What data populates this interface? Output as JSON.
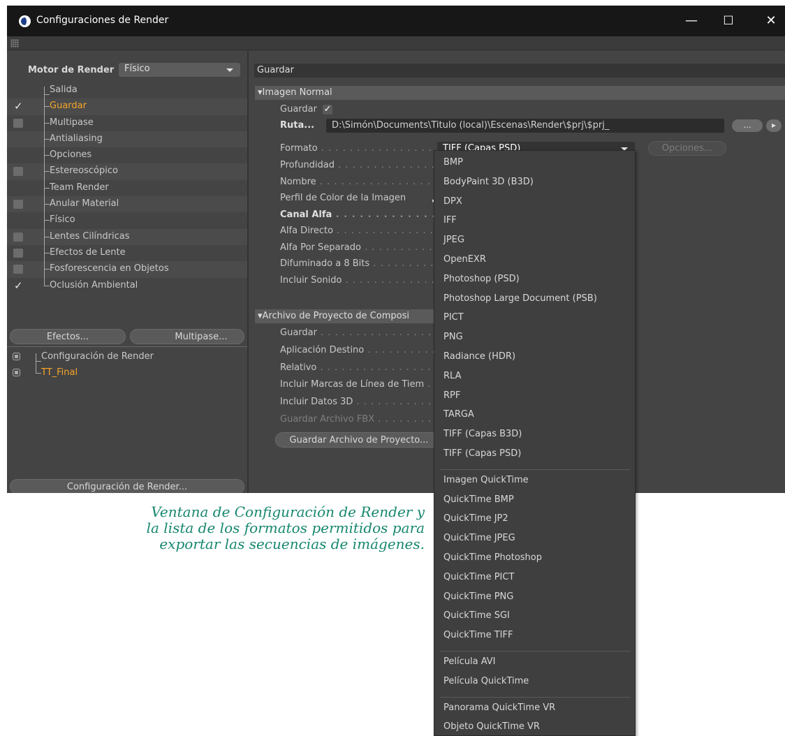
{
  "window": {
    "title": "Configuraciones de Render",
    "minimize": "—",
    "maximize": "☐",
    "close": "✕"
  },
  "left": {
    "engine_label": "Motor de Render",
    "engine_value": "Físico",
    "items": [
      {
        "label": "Salida",
        "checkbox": "none",
        "active": false
      },
      {
        "label": "Guardar",
        "checkbox": "checked",
        "active": true
      },
      {
        "label": "Multipase",
        "checkbox": "unchecked",
        "active": false
      },
      {
        "label": "Antialiasing",
        "checkbox": "none",
        "active": false
      },
      {
        "label": "Opciones",
        "checkbox": "none",
        "active": false
      },
      {
        "label": "Estereoscópico",
        "checkbox": "unchecked",
        "active": false
      },
      {
        "label": "Team Render",
        "checkbox": "none",
        "active": false
      },
      {
        "label": "Anular Material",
        "checkbox": "unchecked",
        "active": false
      },
      {
        "label": "Físico",
        "checkbox": "none",
        "active": false
      },
      {
        "label": "Lentes Cilíndricas",
        "checkbox": "unchecked",
        "active": false
      },
      {
        "label": "Efectos de Lente",
        "checkbox": "unchecked",
        "active": false
      },
      {
        "label": "Fosforescencia en Objetos",
        "checkbox": "unchecked",
        "active": false
      },
      {
        "label": "Oclusión Ambiental",
        "checkbox": "checked",
        "active": false
      }
    ],
    "effects_button": "Efectos...",
    "multipass_button": "Multipase...",
    "presets": [
      {
        "label": "Configuración de Render",
        "active": false
      },
      {
        "label": "TT_Final",
        "active": true
      }
    ],
    "render_settings_button": "Configuración de Render..."
  },
  "right": {
    "title": "Guardar",
    "section_image": "▾Imagen Normal",
    "guardar_label": "Guardar",
    "guardar_check": "✓",
    "ruta_label": "Ruta...",
    "path_value": "D:\\Simón\\Documents\\Titulo (local)\\Escenas\\Render\\$prj\\$prj_",
    "path_button": "...",
    "path_arrow": "▸",
    "format_label": "Formato",
    "format_value": "TIFF (Capas PSD)",
    "options_button": "Opciones...",
    "image_props": [
      {
        "label": "Profundidad",
        "style": "normal"
      },
      {
        "label": "Nombre",
        "style": "normal"
      },
      {
        "label": "Perfil de Color de la Imagen",
        "style": "normal"
      },
      {
        "label": "Canal Alfa",
        "style": "bold"
      },
      {
        "label": "Alfa Directo",
        "style": "normal"
      },
      {
        "label": "Alfa Por Separado",
        "style": "normal"
      },
      {
        "label": "Difuminado a 8 Bits",
        "style": "normal"
      },
      {
        "label": "Incluir Sonido",
        "style": "normal"
      }
    ],
    "profile_arrow": "▸",
    "section_project": "▾Archivo de Proyecto de Composi",
    "project_props": [
      {
        "label": "Guardar",
        "style": "normal"
      },
      {
        "label": "Aplicación Destino",
        "style": "normal"
      },
      {
        "label": "Relativo",
        "style": "normal"
      },
      {
        "label": "Incluir Marcas de Línea de Tiem",
        "style": "normal"
      },
      {
        "label": "Incluir Datos 3D",
        "style": "normal"
      },
      {
        "label": "Guardar Archivo FBX",
        "style": "dim"
      }
    ],
    "save_project_button": "Guardar Archivo de Proyecto..."
  },
  "dropdown": {
    "groups": [
      [
        "BMP",
        "BodyPaint 3D (B3D)",
        "DPX",
        "IFF",
        "JPEG",
        "OpenEXR",
        "Photoshop (PSD)",
        "Photoshop Large Document (PSB)",
        "PICT",
        "PNG",
        "Radiance (HDR)",
        "RLA",
        "RPF",
        "TARGA",
        "TIFF (Capas B3D)",
        "TIFF (Capas PSD)"
      ],
      [
        "Imagen QuickTime",
        "QuickTime BMP",
        "QuickTime JP2",
        "QuickTime JPEG",
        "QuickTime Photoshop",
        "QuickTime PICT",
        "QuickTime PNG",
        "QuickTime SGI",
        "QuickTime TIFF"
      ],
      [
        "Película AVI",
        "Película QuickTime"
      ],
      [
        "Panorama QuickTime VR",
        "Objeto QuickTime VR"
      ]
    ]
  },
  "caption": {
    "lines": [
      "Ventana de Configuración de Render y",
      "la lista de los formatos permitidos para",
      "exportar las secuencias de imágenes."
    ]
  },
  "colors": {
    "active_item": "#f7a529",
    "caption": "#17876f",
    "window_bg": "#444444",
    "titlebar": "#171717"
  }
}
